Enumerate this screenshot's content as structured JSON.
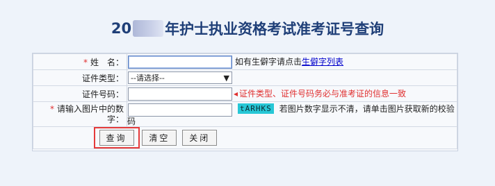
{
  "header": {
    "title_prefix": "20",
    "title_main": "年护士执业资格考试准考证号查询"
  },
  "form": {
    "name": {
      "label": "姓　名：",
      "required_mark": "*",
      "value": "",
      "hint_prefix": "如有生僻字请点击",
      "link_label": "生僻字列表"
    },
    "id_type": {
      "label": "证件类型：",
      "selected": "--请选择--"
    },
    "id_number": {
      "label": "证件号码：",
      "value": "",
      "error": "证件类型、证件号码务必与准考证的信息一致"
    },
    "captcha": {
      "label_line1": "请输入图片中的数",
      "label_line2": "字：",
      "required_mark": "*",
      "value": "",
      "image_text": "tARHKS",
      "hint_line1": "若图片数字显示不清，请单击图片获取新的校验",
      "hint_line2": "码"
    }
  },
  "buttons": {
    "query": "查询",
    "clear": "清空",
    "close": "关闭"
  },
  "colors": {
    "title": "#1f3f78",
    "required": "#e03030",
    "link": "#0000cc",
    "highlight_border": "#e53a3a",
    "captcha_bg": "#27c7d6"
  }
}
